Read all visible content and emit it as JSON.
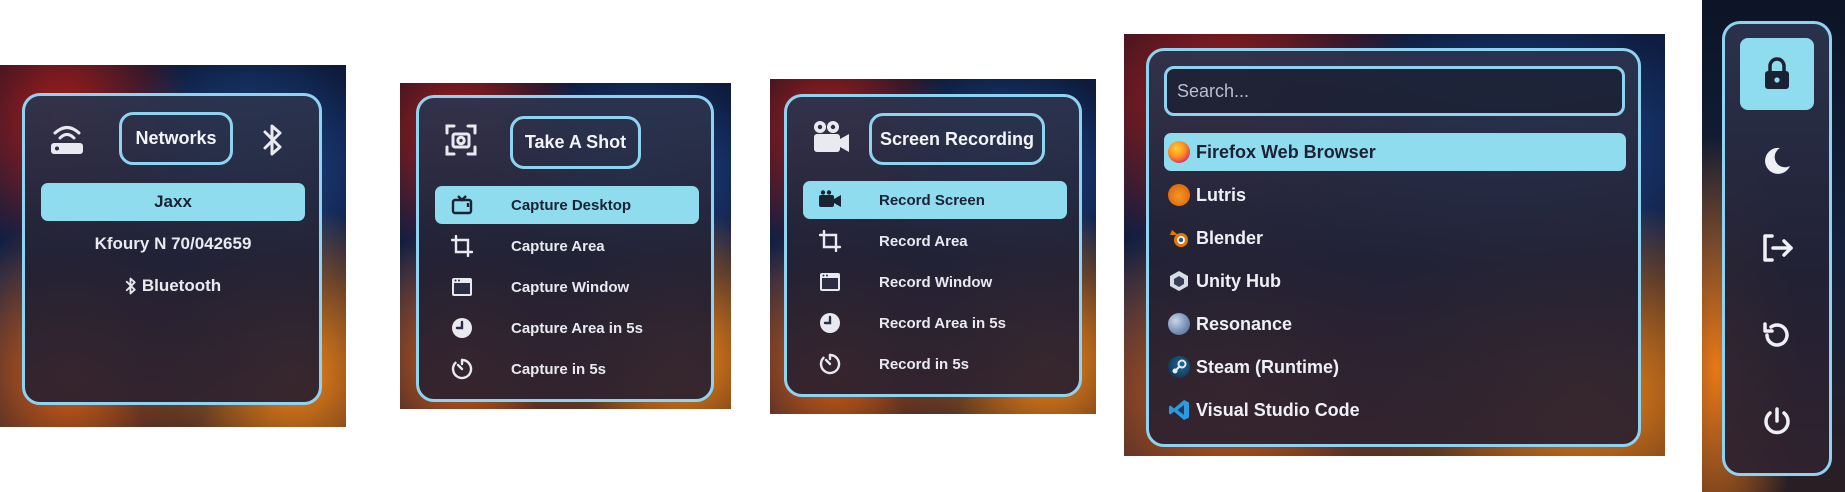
{
  "network_menu": {
    "title": "Networks",
    "icons": {
      "left": "router-icon",
      "right": "bluetooth-icon"
    },
    "items": [
      {
        "label": "Jaxx",
        "active": true
      },
      {
        "label": "Kfoury N 70/042659",
        "active": false
      },
      {
        "label": "Bluetooth",
        "icon": "bluetooth-icon",
        "active": false
      }
    ]
  },
  "screenshot_menu": {
    "title": "Take A Shot",
    "icon": "screenshot-icon",
    "items": [
      {
        "label": "Capture Desktop",
        "icon": "tv-icon",
        "active": true
      },
      {
        "label": "Capture Area",
        "icon": "crop-icon",
        "active": false
      },
      {
        "label": "Capture Window",
        "icon": "window-icon",
        "active": false
      },
      {
        "label": "Capture Area in 5s",
        "icon": "clock-icon",
        "active": false
      },
      {
        "label": "Capture in 5s",
        "icon": "timer-icon",
        "active": false
      }
    ]
  },
  "recording_menu": {
    "title": "Screen Recording",
    "icon": "video-camera-icon",
    "items": [
      {
        "label": "Record Screen",
        "icon": "video-icon",
        "active": true
      },
      {
        "label": "Record Area",
        "icon": "crop-icon",
        "active": false
      },
      {
        "label": "Record Window",
        "icon": "window-icon",
        "active": false
      },
      {
        "label": "Record Area in 5s",
        "icon": "clock-icon",
        "active": false
      },
      {
        "label": "Record in 5s",
        "icon": "timer-icon",
        "active": false
      }
    ]
  },
  "app_launcher": {
    "search_placeholder": "Search...",
    "apps": [
      {
        "label": "Firefox Web Browser",
        "icon": "firefox-icon",
        "active": true
      },
      {
        "label": "Lutris",
        "icon": "lutris-icon",
        "active": false
      },
      {
        "label": "Blender",
        "icon": "blender-icon",
        "active": false
      },
      {
        "label": "Unity Hub",
        "icon": "unity-icon",
        "active": false
      },
      {
        "label": "Resonance",
        "icon": "resonance-icon",
        "active": false
      },
      {
        "label": "Steam (Runtime)",
        "icon": "steam-icon",
        "active": false
      },
      {
        "label": "Visual Studio Code",
        "icon": "vscode-icon",
        "active": false
      }
    ]
  },
  "power_menu": {
    "buttons": [
      {
        "icon": "lock-icon",
        "active": true
      },
      {
        "icon": "moon-icon",
        "active": false
      },
      {
        "icon": "logout-icon",
        "active": false
      },
      {
        "icon": "restart-icon",
        "active": false
      },
      {
        "icon": "power-icon",
        "active": false
      }
    ]
  },
  "colors": {
    "accent": "#8fd3f2",
    "highlight": "#8fdcef",
    "panel": "#2a2b40",
    "text": "#e8eaf0"
  }
}
